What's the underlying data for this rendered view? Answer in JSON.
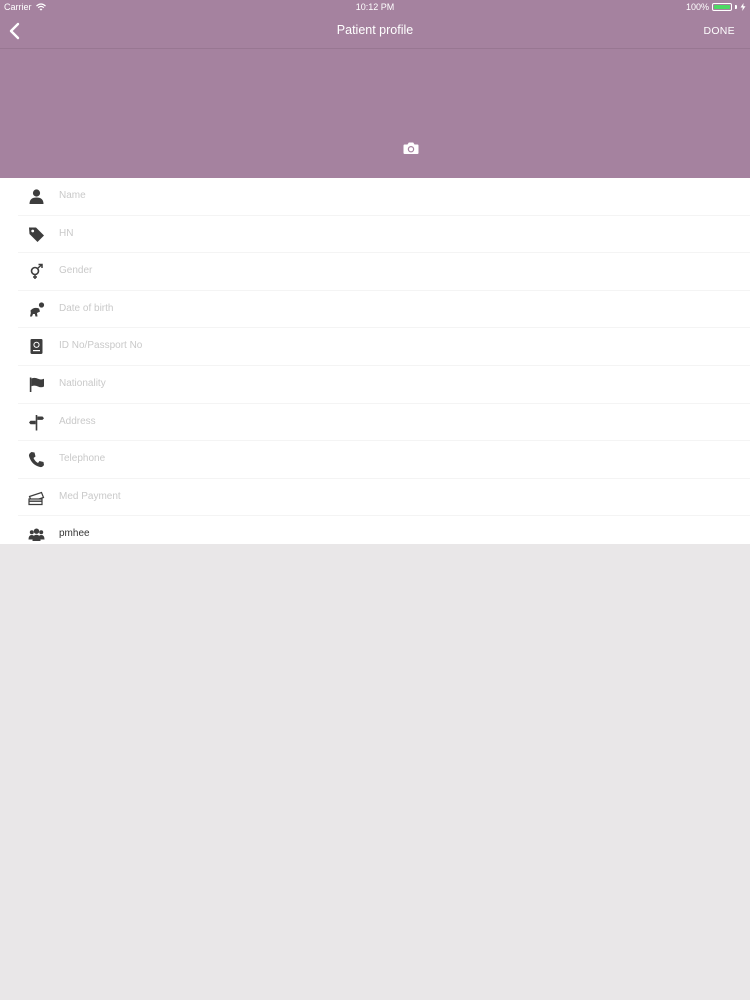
{
  "status_bar": {
    "carrier": "Carrier",
    "time": "10:12 PM",
    "battery": "100%"
  },
  "nav": {
    "title": "Patient profile",
    "done_label": "DONE"
  },
  "colors": {
    "header": "#a5829f",
    "background": "#e9e7e8",
    "battery_fill": "#4cd964"
  },
  "fields": [
    {
      "placeholder": "Name",
      "icon": "person-icon"
    },
    {
      "placeholder": "HN",
      "icon": "tag-icon"
    },
    {
      "placeholder": "Gender",
      "icon": "gender-icon"
    },
    {
      "placeholder": "Date of birth",
      "icon": "baby-icon"
    },
    {
      "placeholder": "ID No/Passport No",
      "icon": "passport-icon"
    },
    {
      "placeholder": "Nationality",
      "icon": "flag-icon"
    },
    {
      "placeholder": "Address",
      "icon": "signpost-icon"
    },
    {
      "placeholder": "Telephone",
      "icon": "phone-icon"
    },
    {
      "placeholder": "Med Payment",
      "icon": "cards-icon"
    },
    {
      "value": "pmhee",
      "icon": "group-icon"
    }
  ]
}
